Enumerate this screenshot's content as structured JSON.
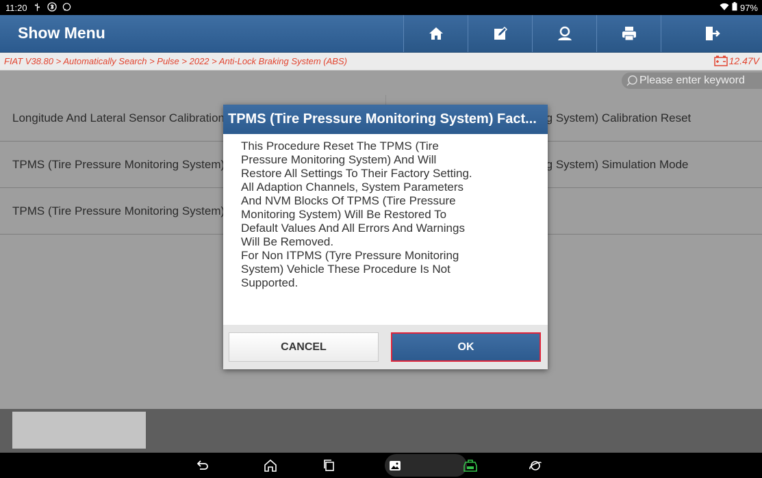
{
  "status_bar": {
    "time": "11:20",
    "battery": "97%",
    "left_icons": [
      "usb-debug-icon",
      "bluetooth-icon",
      "chat-icon"
    ],
    "right_icons": [
      "wifi-icon",
      "battery-icon"
    ]
  },
  "header": {
    "title": "Show Menu",
    "buttons": [
      "home-icon",
      "edit-report-icon",
      "user-icon",
      "print-icon",
      "exit-icon"
    ]
  },
  "breadcrumb": {
    "path": "FIAT V38.80 > Automatically Search > Pulse > 2022 > Anti-Lock Braking System (ABS)",
    "voltage": "12.47V"
  },
  "search": {
    "placeholder": "Please enter keyword"
  },
  "menu": {
    "rows": [
      {
        "left": "Longitude And Lateral Sensor Calibration",
        "right": "TPMS (Tire Pressure Monitoring System) Calibration Reset"
      },
      {
        "left": "TPMS (Tire Pressure Monitoring System) Factory Reset",
        "right": "TPMS (Tire Pressure Monitoring System) Simulation Mode"
      },
      {
        "left": "TPMS (Tire Pressure Monitoring System) Sensor",
        "right": ""
      }
    ]
  },
  "dialog": {
    "title": "TPMS (Tire Pressure Monitoring System) Fact...",
    "lines": [
      "This Procedure Reset The TPMS (Tire",
      "Pressure Monitoring System) And Will",
      "Restore All Settings To Their Factory Setting.",
      "All Adaption Channels, System Parameters",
      "And NVM Blocks Of TPMS (Tire Pressure",
      "Monitoring System) Will Be Restored To",
      "Default Values And All Errors And Warnings",
      "Will Be Removed.",
      "For Non ITPMS (Tyre Pressure Monitoring",
      "System) Vehicle These Procedure Is Not",
      "Supported."
    ],
    "cancel_label": "CANCEL",
    "ok_label": "OK"
  },
  "nav_bar": {
    "items": [
      "back-icon",
      "home-icon",
      "recents-icon",
      "gallery-icon",
      "vci-icon",
      "browser-icon"
    ]
  },
  "colors": {
    "header_blue": "#2b5a8e",
    "breadcrumb_red": "#e2432e",
    "ok_border_red": "#e0243a"
  }
}
